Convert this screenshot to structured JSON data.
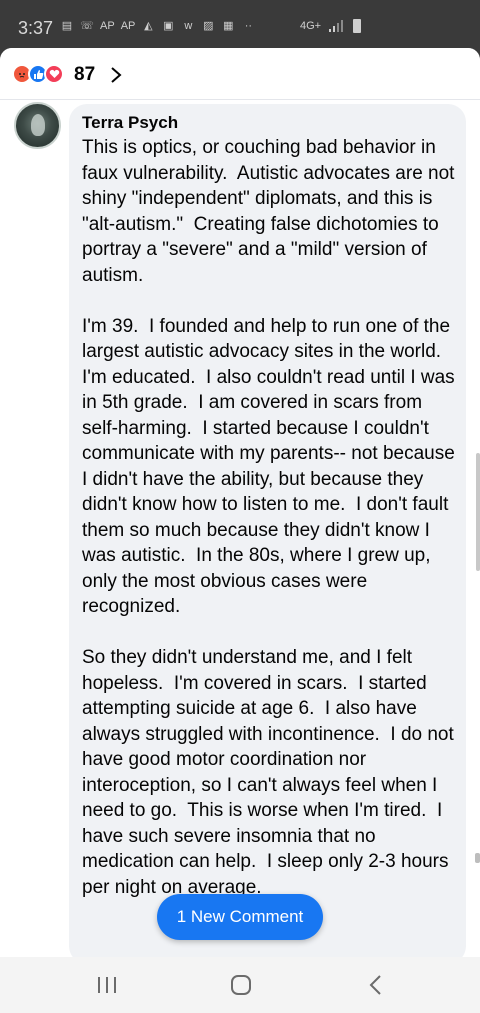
{
  "status_bar": {
    "time": "3:37",
    "icons": [
      "message-icon",
      "missed-call-icon",
      "ap-news-icon",
      "ap-news-icon",
      "photos-icon",
      "gallery-icon",
      "webtoon-icon",
      "image-icon",
      "calendar-icon",
      "more-dots-icon"
    ],
    "icon_labels": [
      "▤",
      "☏",
      "AP",
      "AP",
      "◭",
      "▣",
      "w",
      "▨",
      "▦",
      "··"
    ],
    "network": "4G+",
    "signal": "signal-icon",
    "battery": "battery-icon"
  },
  "reactions": {
    "icons": [
      "angry-reaction",
      "like-reaction",
      "love-reaction"
    ],
    "count": "87"
  },
  "comment": {
    "author": "Terra Psych",
    "text": "This is optics, or couching bad behavior in faux vulnerability.  Autistic advocates are not shiny \"independent\" diplomats, and this is \"alt-autism.\"  Creating false dichotomies to portray a \"severe\" and a \"mild\" version of autism.\n\nI'm 39.  I founded and help to run one of the largest autistic advocacy sites in the world.  I'm educated.  I also couldn't read until I was in 5th grade.  I am covered in scars from self-harming.  I started because I couldn't communicate with my parents-- not because I didn't have the ability, but because they didn't know how to listen to me.  I don't fault them so much because they didn't know I was autistic.  In the 80s, where I grew up, only the most obvious cases were recognized.\n\nSo they didn't understand me, and I felt hopeless.  I'm covered in scars.  I started attempting suicide at age 6.  I also have always struggled with incontinence.  I do not have good motor coordination nor interoception, so I can't always feel when I need to go.  This is worse when I'm tired.  I have such severe insomnia that no medication can help.  I sleep only 2-3 hours per night on average."
  },
  "new_comment_button": "1 New Comment",
  "colors": {
    "accent": "#1877f2",
    "bubble": "#f0f2f5",
    "angry": "#f0573c",
    "love": "#f33e58"
  }
}
